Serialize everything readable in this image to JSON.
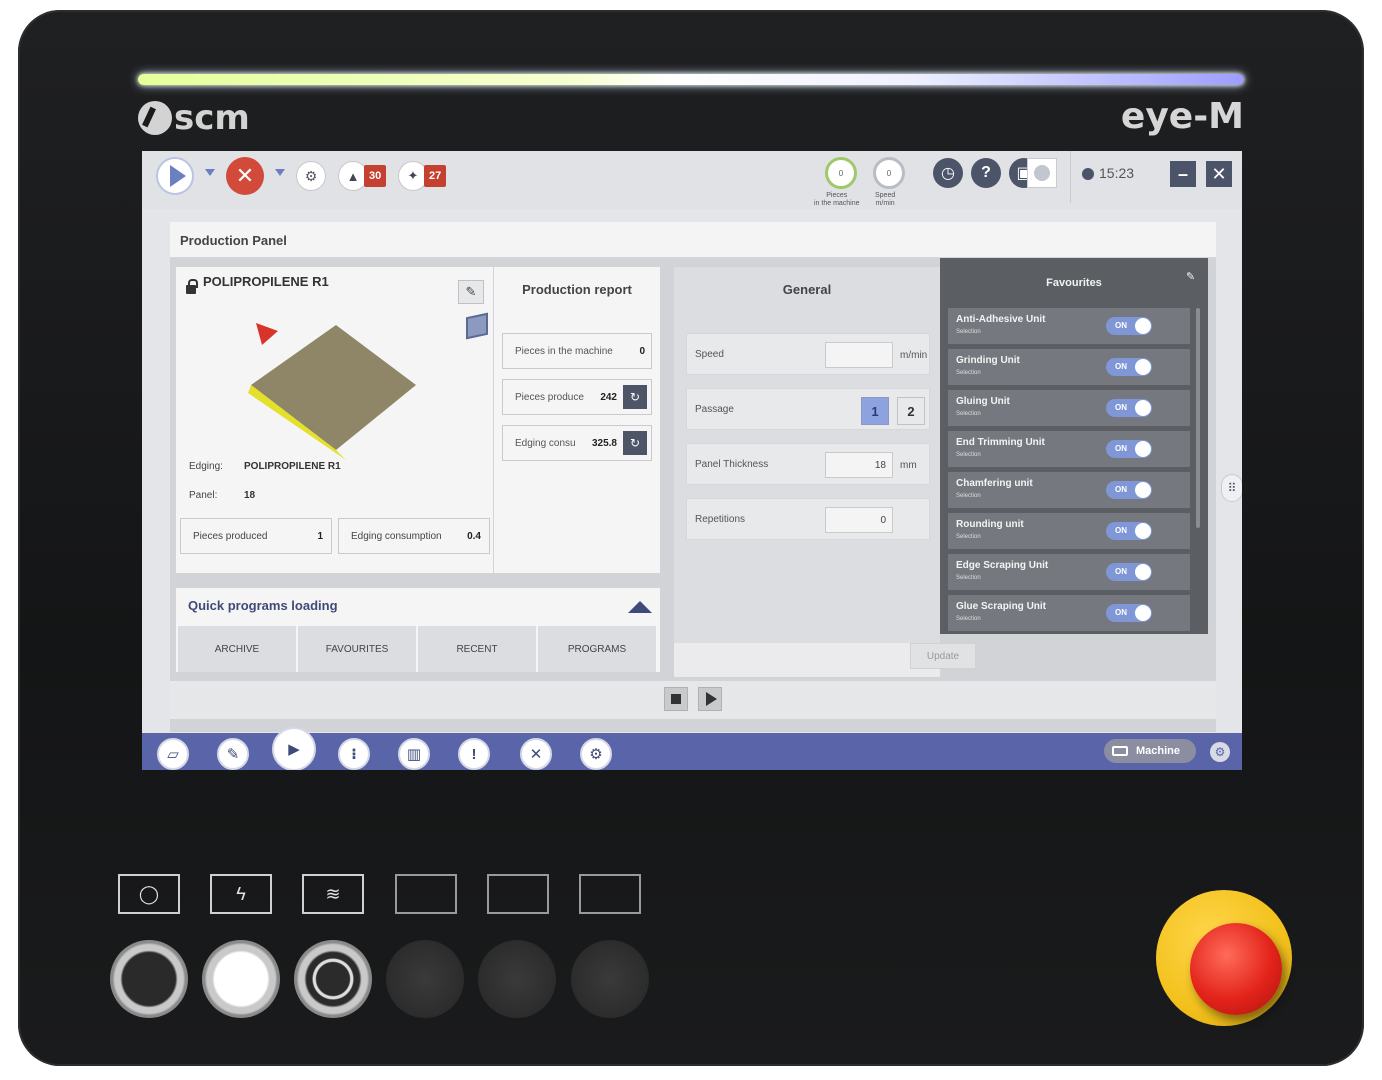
{
  "device": {
    "brand": "scm",
    "model": "eye-M"
  },
  "topbar": {
    "counter_a": "30",
    "counter_b": "27",
    "gauges": [
      {
        "value": "0",
        "caption_1": "Pieces",
        "caption_2": "in the machine"
      },
      {
        "value": "0",
        "caption_1": "Speed",
        "caption_2": "m/min"
      }
    ],
    "time": "15:23",
    "help_label": "?"
  },
  "panel": {
    "title": "Production Panel",
    "item": {
      "name": "POLIPROPILENE R1",
      "edging_label": "Edging:",
      "edging_value": "POLIPROPILENE R1",
      "panel_label": "Panel:",
      "panel_value": "18",
      "pieces_label": "Pieces produced",
      "pieces_value": "1",
      "edging_consumption_label": "Edging consumption",
      "edging_consumption_value": "0.4"
    },
    "report": {
      "title": "Production report",
      "rows": [
        {
          "label": "Pieces in the machine",
          "value": "0"
        },
        {
          "label": "Pieces produce",
          "value": "242"
        },
        {
          "label": "Edging consu",
          "value": "325.8"
        }
      ]
    },
    "quick": {
      "title": "Quick programs loading",
      "tabs": [
        "ARCHIVE",
        "FAVOURITES",
        "RECENT",
        "PROGRAMS"
      ]
    },
    "general": {
      "title": "General",
      "speed_label": "Speed",
      "speed_value": "",
      "speed_unit": "m/min",
      "passage_label": "Passage",
      "passage_options": [
        "1",
        "2"
      ],
      "passage_selected": "1",
      "thickness_label": "Panel Thickness",
      "thickness_value": "18",
      "thickness_unit": "mm",
      "repetitions_label": "Repetitions",
      "repetitions_value": "0",
      "update_label": "Update"
    },
    "favourites": {
      "title": "Favourites",
      "items": [
        {
          "name": "Anti-Adhesive Unit",
          "sub": "Selection",
          "state": "ON"
        },
        {
          "name": "Grinding Unit",
          "sub": "Selection",
          "state": "ON"
        },
        {
          "name": "Gluing Unit",
          "sub": "Selection",
          "state": "ON"
        },
        {
          "name": "End Trimming Unit",
          "sub": "Selection",
          "state": "ON"
        },
        {
          "name": "Chamfering unit",
          "sub": "Selection",
          "state": "ON"
        },
        {
          "name": "Rounding unit",
          "sub": "Selection",
          "state": "ON"
        },
        {
          "name": "Edge Scraping Unit",
          "sub": "Selection",
          "state": "ON"
        },
        {
          "name": "Glue Scraping Unit",
          "sub": "Selection",
          "state": "ON"
        }
      ]
    }
  },
  "bottom_nav": {
    "machine_label": "Machine",
    "alert_label": "!"
  },
  "colors": {
    "accent": "#5a64a8",
    "stop": "#d24a3a",
    "badge": "#c4402f",
    "toggle_on": "#7f97d6",
    "panel_face": "#8f8668",
    "edge_band": "#e5e02a"
  }
}
